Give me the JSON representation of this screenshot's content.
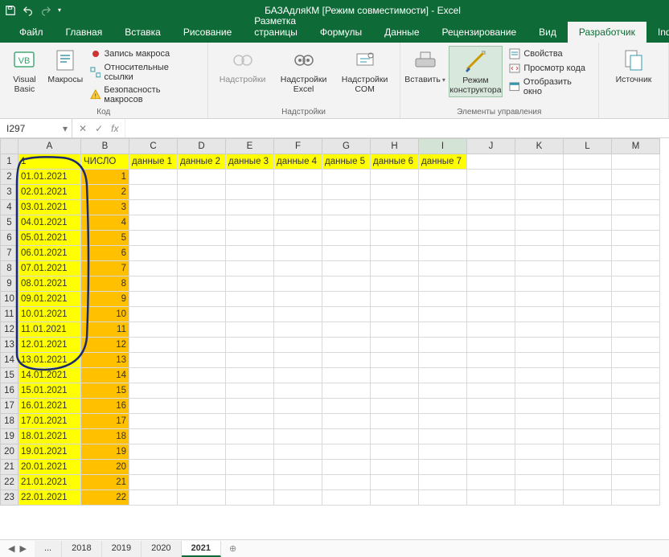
{
  "title": "БАЗАдляКМ  [Режим совместимости]  -  Excel",
  "ribbon_tabs": {
    "file": "Файл",
    "home": "Главная",
    "insert": "Вставка",
    "draw": "Рисование",
    "pagelayout": "Разметка страницы",
    "formulas": "Формулы",
    "data": "Данные",
    "review": "Рецензирование",
    "view": "Вид",
    "developer": "Разработчик",
    "inquire": "Inqu"
  },
  "ribbon": {
    "visual_basic": "Visual\nBasic",
    "macros": "Макросы",
    "record_macro": "Запись макроса",
    "relative_refs": "Относительные ссылки",
    "macro_security": "Безопасность макросов",
    "group_code": "Код",
    "addins": "Надстройки",
    "excel_addins": "Надстройки\nExcel",
    "com_addins": "Надстройки\nCOM",
    "group_addins": "Надстройки",
    "insert_ctrl": "Вставить",
    "design_mode": "Режим\nконструктора",
    "properties": "Свойства",
    "view_code": "Просмотр кода",
    "run_dialog": "Отобразить окно",
    "group_controls": "Элементы управления",
    "source": "Источник"
  },
  "namebox": "I297",
  "fx_label": "fx",
  "columns": [
    "A",
    "B",
    "C",
    "D",
    "E",
    "F",
    "G",
    "H",
    "I",
    "J",
    "K",
    "L",
    "M"
  ],
  "row1": {
    "A": "1",
    "B": "ЧИСЛО",
    "C": "данные 1",
    "D": "данные 2",
    "E": "данные 3",
    "F": "данные 4",
    "G": "данные 5",
    "H": "данные 6",
    "I": "данные 7"
  },
  "rows": [
    {
      "n": 2,
      "A": "01.01.2021",
      "B": "1"
    },
    {
      "n": 3,
      "A": "02.01.2021",
      "B": "2"
    },
    {
      "n": 4,
      "A": "03.01.2021",
      "B": "3"
    },
    {
      "n": 5,
      "A": "04.01.2021",
      "B": "4"
    },
    {
      "n": 6,
      "A": "05.01.2021",
      "B": "5"
    },
    {
      "n": 7,
      "A": "06.01.2021",
      "B": "6"
    },
    {
      "n": 8,
      "A": "07.01.2021",
      "B": "7"
    },
    {
      "n": 9,
      "A": "08.01.2021",
      "B": "8"
    },
    {
      "n": 10,
      "A": "09.01.2021",
      "B": "9"
    },
    {
      "n": 11,
      "A": "10.01.2021",
      "B": "10"
    },
    {
      "n": 12,
      "A": "11.01.2021",
      "B": "11"
    },
    {
      "n": 13,
      "A": "12.01.2021",
      "B": "12"
    },
    {
      "n": 14,
      "A": "13.01.2021",
      "B": "13"
    },
    {
      "n": 15,
      "A": "14.01.2021",
      "B": "14"
    },
    {
      "n": 16,
      "A": "15.01.2021",
      "B": "15"
    },
    {
      "n": 17,
      "A": "16.01.2021",
      "B": "16"
    },
    {
      "n": 18,
      "A": "17.01.2021",
      "B": "17"
    },
    {
      "n": 19,
      "A": "18.01.2021",
      "B": "18"
    },
    {
      "n": 20,
      "A": "19.01.2021",
      "B": "19"
    },
    {
      "n": 21,
      "A": "20.01.2021",
      "B": "20"
    },
    {
      "n": 22,
      "A": "21.01.2021",
      "B": "21"
    },
    {
      "n": 23,
      "A": "22.01.2021",
      "B": "22"
    }
  ],
  "sheets": {
    "ellipsis": "...",
    "s2018": "2018",
    "s2019": "2019",
    "s2020": "2020",
    "s2021": "2021"
  }
}
